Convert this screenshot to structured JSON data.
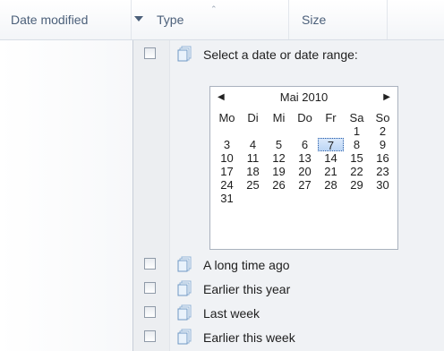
{
  "header": {
    "date_modified": "Date modified",
    "type": "Type",
    "size": "Size",
    "sort_caret": "⌃"
  },
  "filter": {
    "select_label": "Select a date or date range:",
    "options": [
      {
        "label": "A long time ago"
      },
      {
        "label": "Earlier this year"
      },
      {
        "label": "Last week"
      },
      {
        "label": "Earlier this week"
      }
    ]
  },
  "calendar": {
    "month": "Mai 2010",
    "prev_glyph": "◀",
    "next_glyph": "▶",
    "weekdays": [
      "Mo",
      "Di",
      "Mi",
      "Do",
      "Fr",
      "Sa",
      "So"
    ],
    "weeks": [
      [
        "",
        "",
        "",
        "",
        "",
        "1",
        "2"
      ],
      [
        "3",
        "4",
        "5",
        "6",
        "7",
        "8",
        "9"
      ],
      [
        "10",
        "11",
        "12",
        "13",
        "14",
        "15",
        "16"
      ],
      [
        "17",
        "18",
        "19",
        "20",
        "21",
        "22",
        "23"
      ],
      [
        "24",
        "25",
        "26",
        "27",
        "28",
        "29",
        "30"
      ],
      [
        "31",
        "",
        "",
        "",
        "",
        "",
        ""
      ]
    ],
    "today": "7"
  },
  "icons": {
    "dropdown": "chevron-down-icon",
    "stack": "stack-icon",
    "checkbox": "checkbox"
  },
  "colors": {
    "header_text": "#4c607a",
    "panel_bg": "#f0f2f5",
    "today_border": "#2a5ea7"
  }
}
